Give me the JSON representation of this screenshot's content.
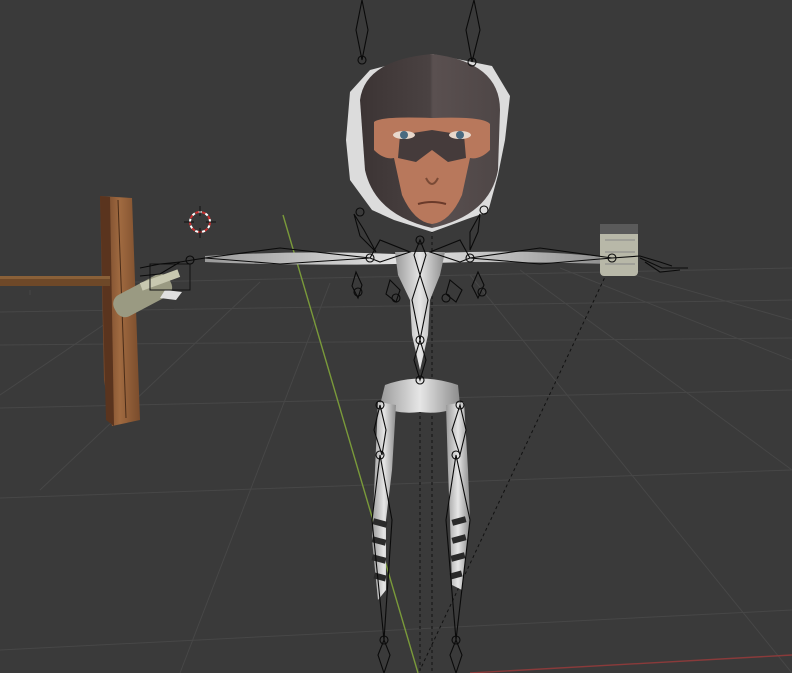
{
  "viewport": {
    "background": "#3a3a3a",
    "grid_color": "#474747",
    "y_axis_color": "#7a9a3a",
    "x_axis_color": "#8a3a3a"
  },
  "scene": {
    "armature_color": "#0a0a0a",
    "mesh_color": "#c8c8c8",
    "head_skin": "#b8785c",
    "balaclava": "#4a4040",
    "wood": "#8a5a36",
    "cursor_color": "#c83030"
  }
}
